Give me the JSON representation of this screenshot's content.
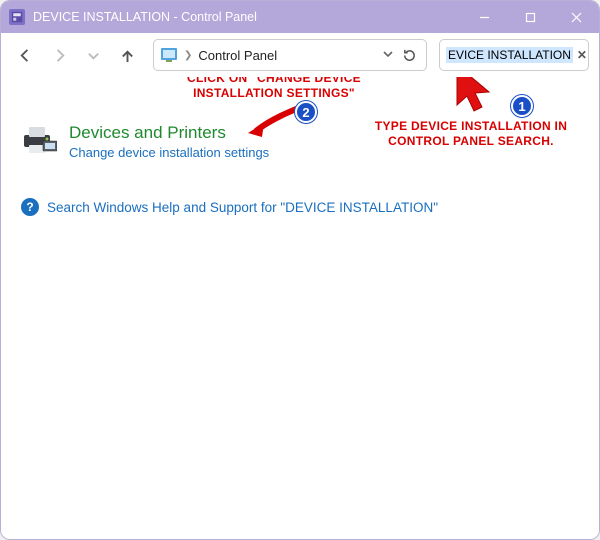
{
  "window": {
    "title": "DEVICE INSTALLATION - Control Panel"
  },
  "toolbar": {
    "breadcrumb_root": "Control Panel"
  },
  "search": {
    "query": "EVICE INSTALLATION"
  },
  "results": {
    "category": "Devices and Printers",
    "sub_link": "Change device installation settings",
    "help_text": "Search Windows Help and Support for \"DEVICE INSTALLATION\""
  },
  "annotations": {
    "step1_text": "TYPE DEVICE INSTALLATION IN CONTROL PANEL SEARCH.",
    "step1_badge": "1",
    "step2_text": "CLICK ON \"CHANGE DEVICE INSTALLATION SETTINGS\"",
    "step2_badge": "2"
  }
}
